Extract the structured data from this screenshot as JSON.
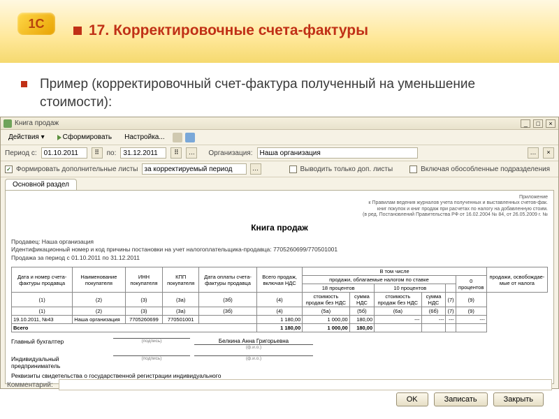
{
  "slide": {
    "number": "17.",
    "title": "Корректировочные счета-фактуры",
    "example": "Пример (корректировочный счет-фактура полученный на уменьшение стоимости):"
  },
  "logo": "1С",
  "window": {
    "title": "Книга продаж",
    "min": "_",
    "max": "□",
    "close": "×"
  },
  "toolbar": {
    "actions": "Действия ▾",
    "generate": "Сформировать",
    "settings": "Настройка..."
  },
  "filters": {
    "period_from_label": "Период с:",
    "period_from": "01.10.2011",
    "period_to_label": "по:",
    "period_to": "31.12.2011",
    "org_label": "Организация:",
    "org": "Наша организация"
  },
  "options": {
    "form_add_sheets": "Формировать дополнительные листы",
    "form_period": "за корректируемый период",
    "only_add": "Выводить только доп. листы",
    "incl_branches": "Включая обособленные подразделения"
  },
  "tab": "Основной раздел",
  "report": {
    "appendix_l1": "Приложение",
    "appendix_l2": "к Правилам ведения журналов учета полученных и выставленных счетов-фак.",
    "appendix_l3": "книг покупок и книг продаж при расчетах по налогу на добавленную стоим.",
    "appendix_l4": "(в ред. Постановлений Правительства РФ от 16.02.2004 № 84, от 26.05.2009 г. №",
    "title": "Книга продаж",
    "seller_l1": "Продавец: Наша организация",
    "seller_l2": "Идентификационный номер и код причины постановки на учет налогоплательщика-продавца: 7705260699/770501001",
    "seller_l3": "Продажа за период с 01.10.2011 по 31.12.2011",
    "thead": {
      "c1": "Дата и номер счета-фактуры продавца",
      "c2": "Наименование покупателя",
      "c3": "ИНН покупателя",
      "c3a": "КПП покупателя",
      "c3b": "Дата оплаты счета-фактуры продавца",
      "c4": "Всего продаж, включая НДС",
      "grp": "В том числе",
      "grp2": "продажи, облагаемые налогом по ставке",
      "p18": "18 процентов",
      "p10": "10 процентов",
      "p0": "0 процентов",
      "c9": "продажи, освобождае-мые от налога",
      "cost": "стоимость продаж без НДС",
      "sum": "сумма НДС",
      "n1": "(1)",
      "n2": "(2)",
      "n3": "(3)",
      "n3a": "(3а)",
      "n3b": "(3б)",
      "n4": "(4)",
      "n5a": "(5а)",
      "n5b": "(5б)",
      "n6a": "(6а)",
      "n6b": "(6б)",
      "n7": "(7)",
      "n9": "(9)"
    },
    "row": {
      "date": "19.10.2011, №43",
      "buyer": "Наша организация",
      "inn": "7705260699",
      "kpp": "770501001",
      "total": "1 180,00",
      "cost18": "1 000,00",
      "vat18": "180,00",
      "dash": "---"
    },
    "total_row": {
      "label": "Всего",
      "total": "1 180,00",
      "cost18": "1 000,00",
      "vat18": "180,00"
    },
    "sig": {
      "chief": "Главный бухгалтер",
      "ip": "Индивидуальный предприниматель",
      "req": "Реквизиты свидетельства о государственной регистрации индивидуального",
      "sign_cap": "(подпись)",
      "fio_cap": "(ф.и.о.)",
      "fio": "Белкина Анна Григорьевна"
    }
  },
  "comment_label": "Комментарий:",
  "buttons": {
    "ok": "OK",
    "save": "Записать",
    "close": "Закрыть"
  }
}
